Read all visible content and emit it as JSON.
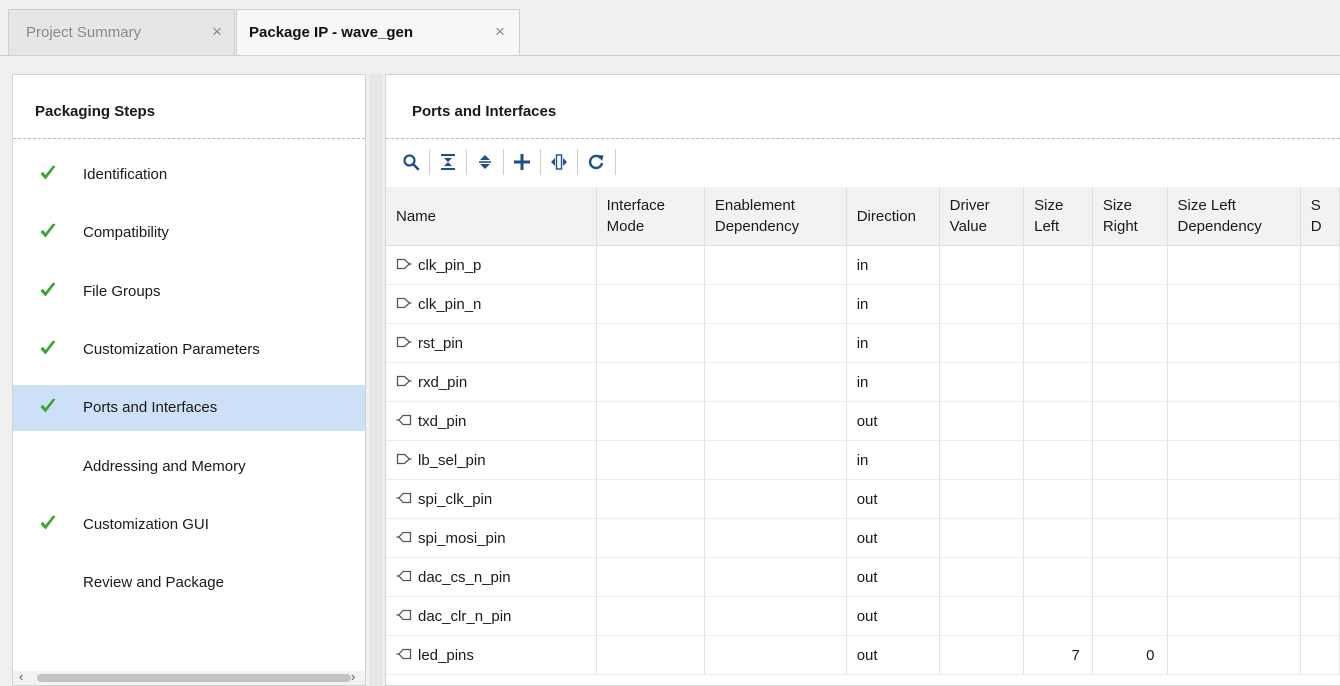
{
  "tabs": [
    {
      "label": "Project Summary",
      "close": "×"
    },
    {
      "label": "Package IP - wave_gen",
      "close": "×"
    }
  ],
  "steps_panel": {
    "title": "Packaging Steps",
    "items": [
      {
        "label": "Identification",
        "checked": true
      },
      {
        "label": "Compatibility",
        "checked": true
      },
      {
        "label": "File Groups",
        "checked": true
      },
      {
        "label": "Customization Parameters",
        "checked": true
      },
      {
        "label": "Ports and Interfaces",
        "checked": true,
        "selected": true
      },
      {
        "label": "Addressing and Memory",
        "checked": false
      },
      {
        "label": "Customization GUI",
        "checked": true
      },
      {
        "label": "Review and Package",
        "checked": false
      }
    ],
    "scroll_left": "‹",
    "scroll_right": "›"
  },
  "ports_panel": {
    "title": "Ports and Interfaces",
    "toolbar": [
      "search-icon",
      "collapse-all-icon",
      "expand-all-icon",
      "add-icon",
      "auto-infer-icon",
      "refresh-icon"
    ],
    "columns": [
      [
        "Name"
      ],
      [
        "Interface",
        "Mode"
      ],
      [
        "Enablement",
        "Dependency"
      ],
      [
        "Direction"
      ],
      [
        "Driver",
        "Value"
      ],
      [
        "Size",
        "Left"
      ],
      [
        "Size",
        "Right"
      ],
      [
        "Size Left",
        "Dependency"
      ],
      [
        "S",
        "D"
      ]
    ],
    "rows": [
      {
        "name": "clk_pin_p",
        "direction": "in",
        "size_left": "",
        "size_right": ""
      },
      {
        "name": "clk_pin_n",
        "direction": "in",
        "size_left": "",
        "size_right": ""
      },
      {
        "name": "rst_pin",
        "direction": "in",
        "size_left": "",
        "size_right": ""
      },
      {
        "name": "rxd_pin",
        "direction": "in",
        "size_left": "",
        "size_right": ""
      },
      {
        "name": "txd_pin",
        "direction": "out",
        "size_left": "",
        "size_right": ""
      },
      {
        "name": "lb_sel_pin",
        "direction": "in",
        "size_left": "",
        "size_right": ""
      },
      {
        "name": "spi_clk_pin",
        "direction": "out",
        "size_left": "",
        "size_right": ""
      },
      {
        "name": "spi_mosi_pin",
        "direction": "out",
        "size_left": "",
        "size_right": ""
      },
      {
        "name": "dac_cs_n_pin",
        "direction": "out",
        "size_left": "",
        "size_right": ""
      },
      {
        "name": "dac_clr_n_pin",
        "direction": "out",
        "size_left": "",
        "size_right": ""
      },
      {
        "name": "led_pins",
        "direction": "out",
        "size_left": "7",
        "size_right": "0"
      }
    ]
  },
  "colors": {
    "check": "#3aa536",
    "selected_row": "#cde0f7",
    "icon_blue": "#1f4e8c"
  }
}
